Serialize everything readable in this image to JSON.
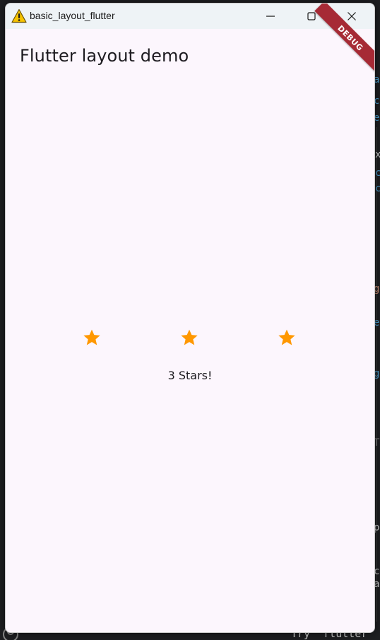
{
  "window": {
    "title": "basic_layout_flutter"
  },
  "app": {
    "title": "Flutter layout demo",
    "debug_banner": "DEBUG",
    "rating_text": "3 Stars!",
    "star_color": "#ff9800",
    "stars": [
      {
        "icon": "star-icon"
      },
      {
        "icon": "star-icon"
      },
      {
        "icon": "star-icon"
      }
    ]
  },
  "background": {
    "terminal_command": "Try `flutter"
  },
  "colors": {
    "window_background": "#fcf6fd",
    "titlebar": "#eef3f6",
    "debug_banner": "#a62a35",
    "editor_background": "#1e1f22"
  }
}
